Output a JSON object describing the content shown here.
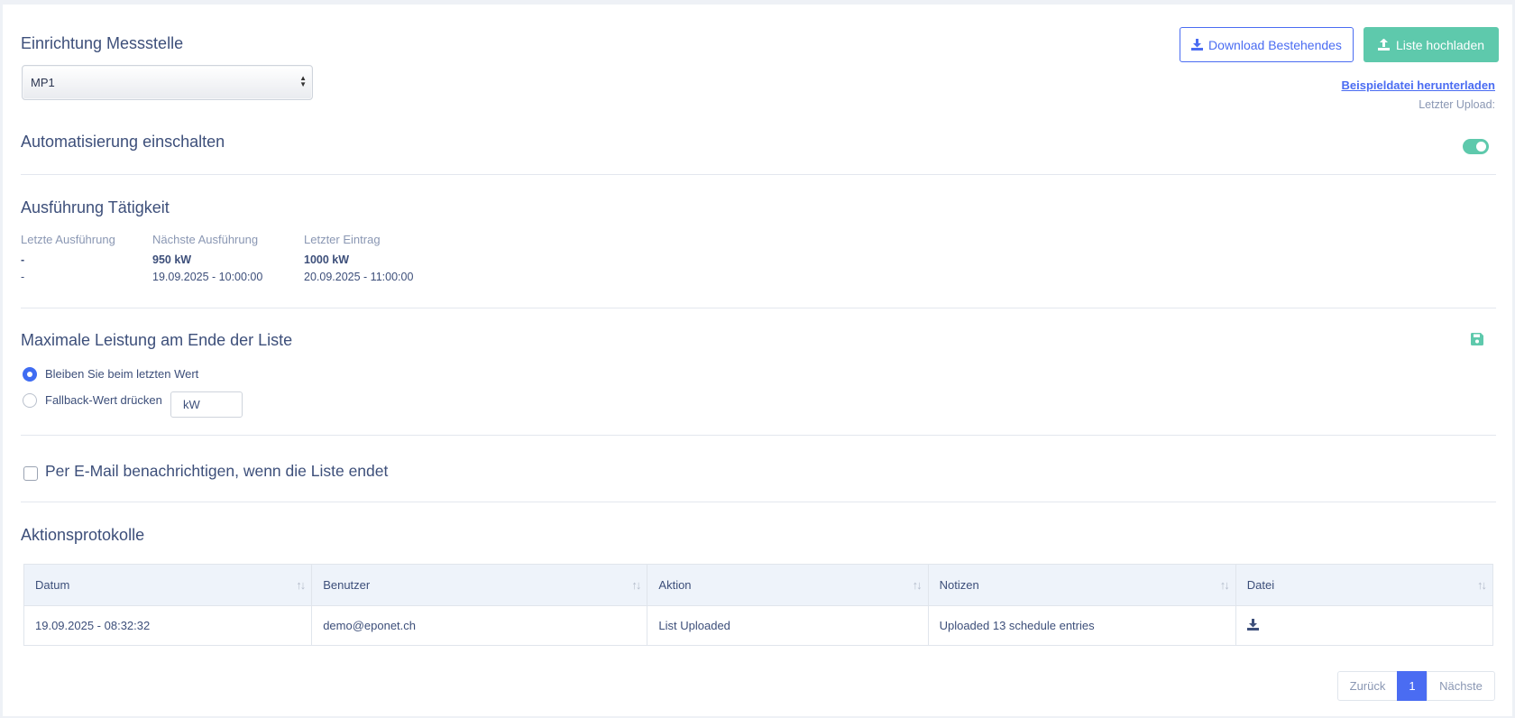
{
  "setup": {
    "title": "Einrichtung Messstelle",
    "select_value": "MP1"
  },
  "actions": {
    "download_label": "Download Bestehendes",
    "upload_label": "Liste hochladen",
    "sample_link": "Beispieldatei herunterladen",
    "last_upload_label": "Letzter Upload:"
  },
  "automation": {
    "title": "Automatisierung einschalten",
    "enabled": true
  },
  "execution": {
    "title": "Ausführung Tätigkeit",
    "columns": [
      {
        "label": "Letzte Ausführung",
        "value": "-",
        "date": "-"
      },
      {
        "label": "Nächste Ausführung",
        "value": "950 kW",
        "date": "19.09.2025 - 10:00:00"
      },
      {
        "label": "Letzter Eintrag",
        "value": "1000 kW",
        "date": "20.09.2025 - 11:00:00"
      }
    ]
  },
  "max_power": {
    "title": "Maximale Leistung am Ende der Liste",
    "option1": "Bleiben Sie beim letzten Wert",
    "option2": "Fallback-Wert drücken",
    "fallback_unit": "kW",
    "selected": "option1"
  },
  "email": {
    "label": "Per E-Mail benachrichtigen, wenn die Liste endet",
    "checked": false
  },
  "log": {
    "title": "Aktionsprotokolle",
    "headers": [
      "Datum",
      "Benutzer",
      "Aktion",
      "Notizen",
      "Datei"
    ],
    "rows": [
      {
        "datum": "19.09.2025 - 08:32:32",
        "benutzer": "demo@eponet.ch",
        "aktion": "List Uploaded",
        "notizen": "Uploaded 13 schedule entries"
      }
    ]
  },
  "pagination": {
    "prev": "Zurück",
    "current": "1",
    "next": "Nächste"
  },
  "colors": {
    "primary": "#4a6cf2",
    "accent_green": "#5ec9ac",
    "text": "#3d4f7a",
    "muted": "#8a97b3"
  }
}
